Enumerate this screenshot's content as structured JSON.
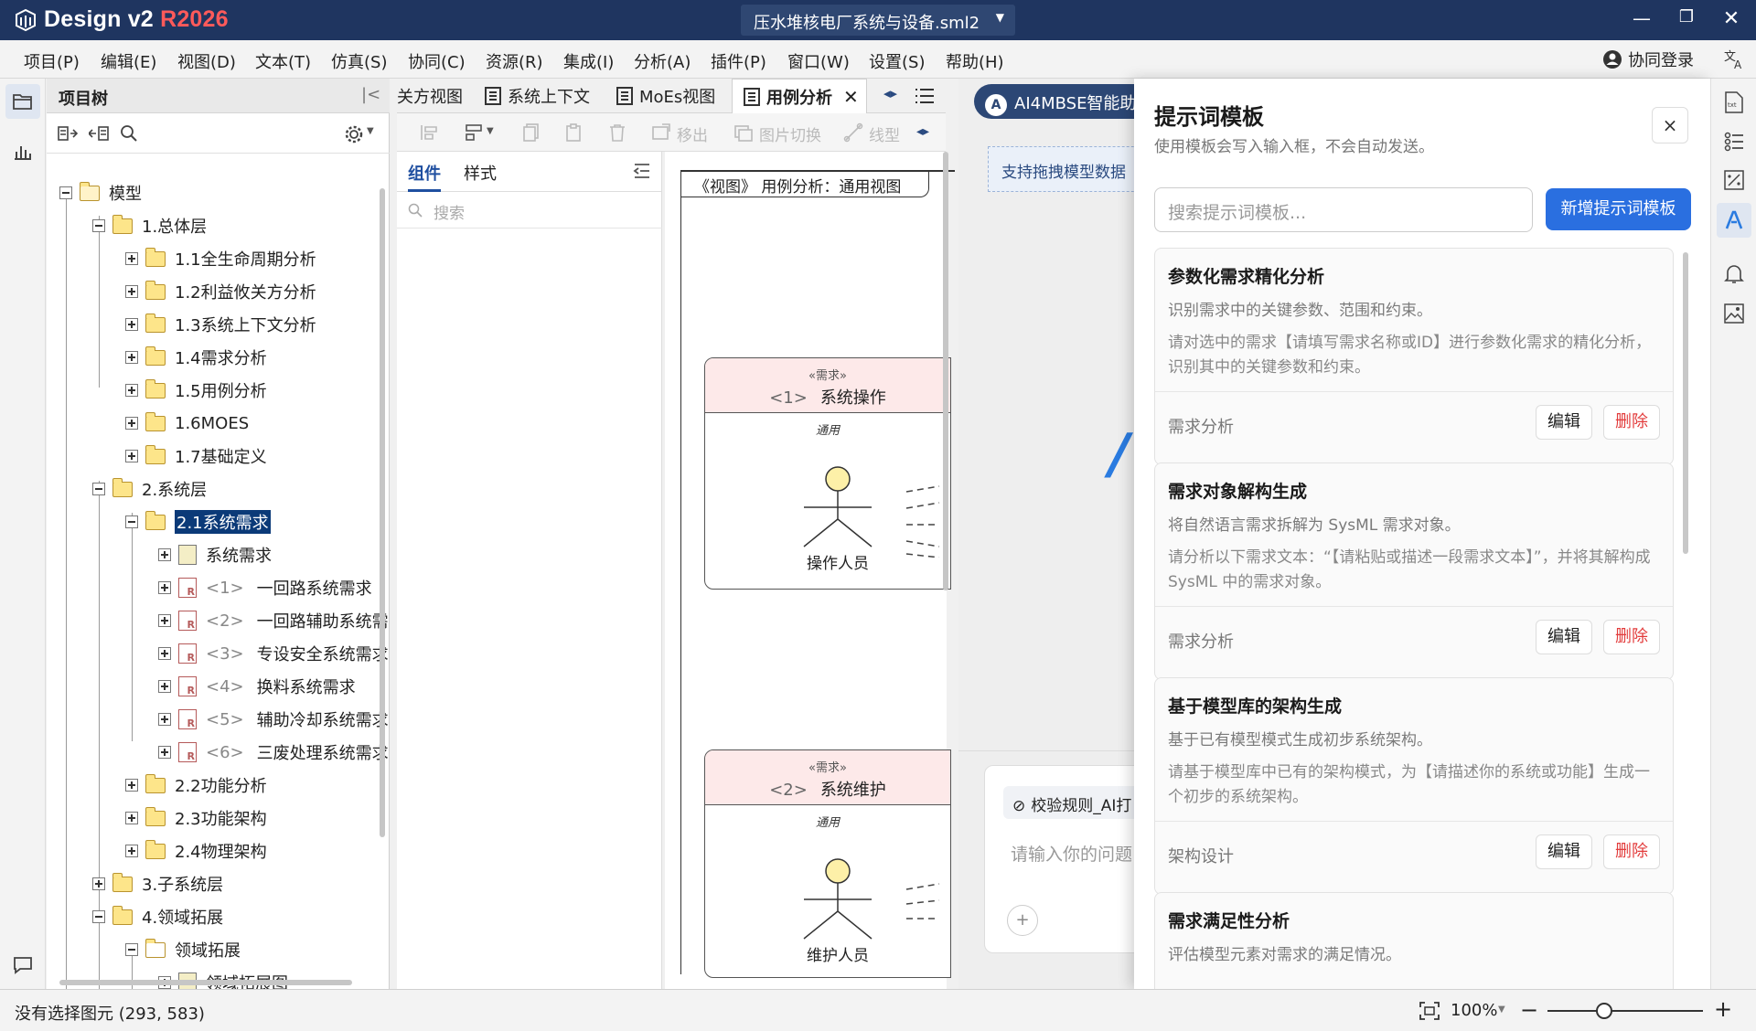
{
  "app": {
    "title_prefix": "Design v2 ",
    "title_version": "R2026",
    "file_name": "压水堆核电厂系统与设备.sml2"
  },
  "menu": [
    "项目(P)",
    "编辑(E)",
    "视图(D)",
    "文本(T)",
    "仿真(S)",
    "协同(C)",
    "资源(R)",
    "集成(I)",
    "分析(A)",
    "插件(P)",
    "窗口(W)",
    "设置(S)",
    "帮助(H)"
  ],
  "collab_login": "协同登录",
  "tree": {
    "title": "项目树",
    "nodes": [
      {
        "label": "模型"
      },
      {
        "label": "1.总体层"
      },
      {
        "label": "1.1全生命周期分析"
      },
      {
        "label": "1.2利益攸关方分析"
      },
      {
        "label": "1.3系统上下文分析"
      },
      {
        "label": "1.4需求分析"
      },
      {
        "label": "1.5用例分析"
      },
      {
        "label": "1.6MOES"
      },
      {
        "label": "1.7基础定义"
      },
      {
        "label": "2.系统层"
      },
      {
        "label": "2.1系统需求"
      },
      {
        "label": "系统需求"
      },
      {
        "label": "一回路系统需求",
        "idx": "<1>"
      },
      {
        "label": "一回路辅助系统需",
        "idx": "<2>"
      },
      {
        "label": "专设安全系统需求",
        "idx": "<3>"
      },
      {
        "label": "换料系统需求",
        "idx": "<4>"
      },
      {
        "label": "辅助冷却系统需求",
        "idx": "<5>"
      },
      {
        "label": "三废处理系统需求",
        "idx": "<6>"
      },
      {
        "label": "2.2功能分析"
      },
      {
        "label": "2.3功能架构"
      },
      {
        "label": "2.4物理架构"
      },
      {
        "label": "3.子系统层"
      },
      {
        "label": "4.领域拓展"
      },
      {
        "label": "领域拓展"
      },
      {
        "label": "领域拓展图"
      }
    ]
  },
  "tabs": [
    {
      "label": "关方视图"
    },
    {
      "label": "系统上下文"
    },
    {
      "label": "MoEs视图"
    },
    {
      "label": "用例分析"
    }
  ],
  "diagram_toolbar": {
    "move_out": "移出",
    "image_switch": "图片切换",
    "line_type": "线型"
  },
  "component_panel": {
    "tab_components": "组件",
    "tab_style": "样式",
    "search_placeholder": "搜索"
  },
  "canvas": {
    "frame_title": "《视图》 用例分析：通用视图",
    "usecases": [
      {
        "stereo": "«需求»",
        "idx": "<1>",
        "name": "系统操作",
        "tag": "通用",
        "actor": "操作人员"
      },
      {
        "stereo": "«需求»",
        "idx": "<2>",
        "name": "系统维护",
        "tag": "通用",
        "actor": "维护人员"
      }
    ]
  },
  "ai_panel": {
    "tab_label": "AI4MBSE智能助",
    "hint": "支持拖拽模型数据",
    "chip": "校验规则_AI打",
    "input_placeholder": "请输入你的问题"
  },
  "drawer": {
    "title": "提示词模板",
    "subtitle": "使用模板会写入输入框，不会自动发送。",
    "close": "×",
    "search_placeholder": "搜索提示词模板...",
    "new_button": "新增提示词模板",
    "edit_label": "编辑",
    "delete_label": "删除",
    "cards": [
      {
        "title": "参数化需求精化分析",
        "desc": "识别需求中的关键参数、范围和约束。",
        "prompt": "请对选中的需求【请填写需求名称或ID】进行参数化需求的精化分析，识别其中的关键参数和约束。",
        "category": "需求分析"
      },
      {
        "title": "需求对象解构生成",
        "desc": "将自然语言需求拆解为 SysML 需求对象。",
        "prompt": "请分析以下需求文本：“【请粘贴或描述一段需求文本】”，并将其解构成 SysML 中的需求对象。",
        "category": "需求分析"
      },
      {
        "title": "基于模型库的架构生成",
        "desc": "基于已有模型模式生成初步系统架构。",
        "prompt": "请基于模型库中已有的架构模式，为【请描述你的系统或功能】生成一个初步的系统架构。",
        "category": "架构设计"
      },
      {
        "title": "需求满足性分析",
        "desc": "评估模型元素对需求的满足情况。",
        "prompt": "",
        "category": ""
      }
    ]
  },
  "status": {
    "text": "没有选择图元 (293, 583)",
    "zoom": "100%"
  },
  "colors": {
    "titlebar": "#1f3560",
    "version_red": "#ff5a5a",
    "primary_button": "#2a6fe0",
    "delete_red": "#e23b3b",
    "selection": "#0b3a78"
  }
}
